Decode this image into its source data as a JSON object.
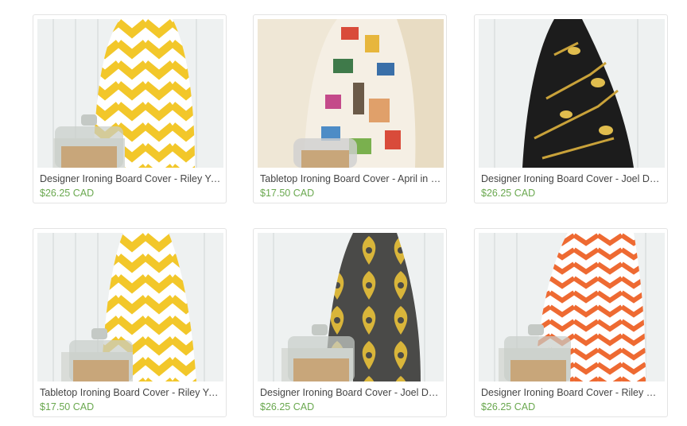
{
  "products": [
    {
      "title": "Designer Ironing Board Cover - Riley Yellow Chevron",
      "price": "$26.25 CAD",
      "pattern": "yellow-chevron"
    },
    {
      "title": "Tabletop Ironing Board Cover - April in Paris",
      "price": "$17.50 CAD",
      "pattern": "paris-collage"
    },
    {
      "title": "Designer Ironing Board Cover - Joel Dewberry Sparrows",
      "price": "$26.25 CAD",
      "pattern": "black-sparrows"
    },
    {
      "title": "Tabletop Ironing Board Cover - Riley Yellow Chevron",
      "price": "$17.50 CAD",
      "pattern": "yellow-chevron"
    },
    {
      "title": "Designer Ironing Board Cover - Joel Dewberry Damask",
      "price": "$26.25 CAD",
      "pattern": "yellow-damask"
    },
    {
      "title": "Designer Ironing Board Cover - Riley Orange Chevron",
      "price": "$26.25 CAD",
      "pattern": "orange-chevron"
    }
  ]
}
